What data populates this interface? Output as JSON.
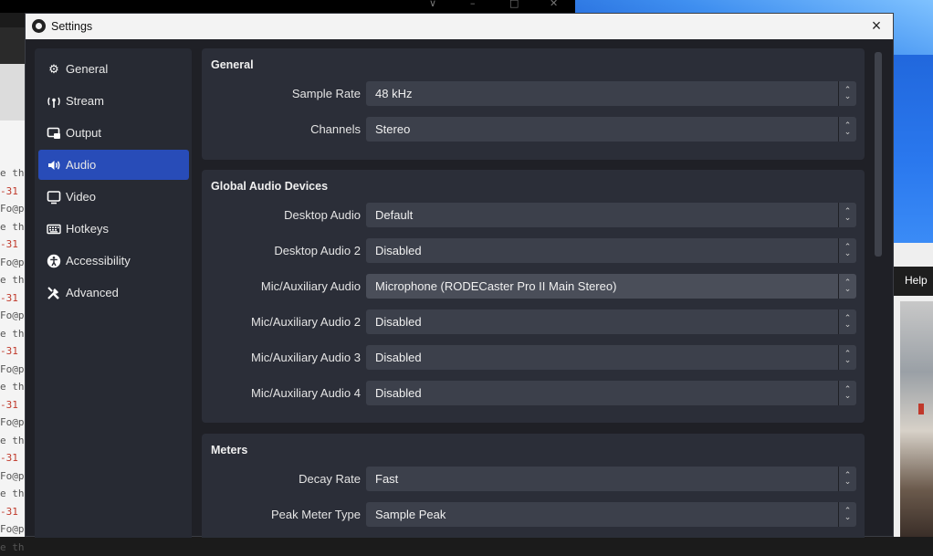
{
  "dialog": {
    "title": "Settings",
    "close_glyph": "×"
  },
  "sidebar": {
    "items": [
      {
        "label": "General",
        "icon": "gear-icon"
      },
      {
        "label": "Stream",
        "icon": "antenna-icon"
      },
      {
        "label": "Output",
        "icon": "output-icon"
      },
      {
        "label": "Audio",
        "icon": "speaker-icon",
        "active": true
      },
      {
        "label": "Video",
        "icon": "monitor-icon"
      },
      {
        "label": "Hotkeys",
        "icon": "keyboard-icon"
      },
      {
        "label": "Accessibility",
        "icon": "accessibility-icon"
      },
      {
        "label": "Advanced",
        "icon": "tools-icon"
      }
    ]
  },
  "general": {
    "title": "General",
    "sample_rate_label": "Sample Rate",
    "sample_rate_value": "48 kHz",
    "channels_label": "Channels",
    "channels_value": "Stereo"
  },
  "devices": {
    "title": "Global Audio Devices",
    "rows": [
      {
        "label": "Desktop Audio",
        "value": "Default"
      },
      {
        "label": "Desktop Audio 2",
        "value": "Disabled"
      },
      {
        "label": "Mic/Auxiliary Audio",
        "value": "Microphone (RODECaster Pro II Main Stereo)"
      },
      {
        "label": "Mic/Auxiliary Audio 2",
        "value": "Disabled"
      },
      {
        "label": "Mic/Auxiliary Audio 3",
        "value": "Disabled"
      },
      {
        "label": "Mic/Auxiliary Audio 4",
        "value": "Disabled"
      }
    ]
  },
  "meters": {
    "title": "Meters",
    "decay_rate_label": "Decay Rate",
    "decay_rate_value": "Fast",
    "peak_meter_label": "Peak Meter Type",
    "peak_meter_value": "Sample Peak"
  },
  "background": {
    "help_menu": "Help",
    "terminal_lines": [
      "e th",
      "-31",
      "Fo@p",
      "e th",
      "-31",
      "Fo@p",
      "e th",
      "-31",
      "Fo@p",
      "e th",
      "-31",
      "Fo@p",
      "e th",
      "-31",
      "Fo@p",
      "e th",
      "-31",
      "Fo@p",
      "e th",
      "-31",
      "Fo@p",
      "e th"
    ]
  },
  "colors": {
    "accent": "#284cb8",
    "panel": "#2b2e38",
    "dialog_bg": "#1f2026"
  }
}
